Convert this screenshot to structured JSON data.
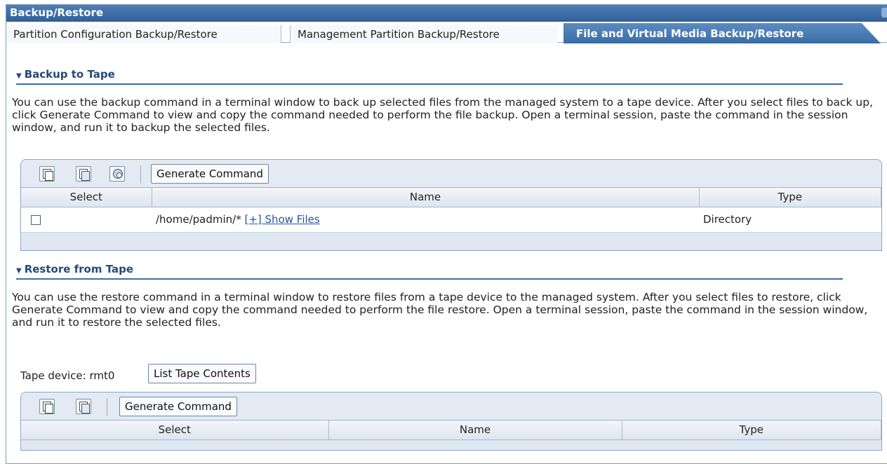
{
  "window": {
    "title": "Backup/Restore"
  },
  "tabs": [
    {
      "label": "Partition Configuration Backup/Restore"
    },
    {
      "label": "Management Partition Backup/Restore"
    },
    {
      "label": "File and Virtual Media Backup/Restore"
    }
  ],
  "backup": {
    "heading": "Backup to Tape",
    "description": "You can use the backup command in a terminal window to back up selected files from the managed system to a tape device. After you select files to back up, click Generate Command to view and copy the command needed to perform the file backup. Open a terminal session, paste the command in the session window, and run it to backup the selected files.",
    "generate_label": "Generate Command",
    "columns": {
      "select": "Select",
      "name": "Name",
      "type": "Type"
    },
    "row": {
      "path": "/home/padmin/*",
      "link": "[+] Show Files",
      "type": "Directory"
    }
  },
  "restore": {
    "heading": "Restore from Tape",
    "description": "You can use the restore command in a terminal window to restore files from a tape device to the managed system. After you select files to restore, click Generate Command to view and copy the command needed to perform the file restore. Open a terminal session, paste the command in the session window, and run it to restore the selected files.",
    "tape_label": "Tape device: rmt0",
    "list_label": "List Tape Contents",
    "generate_label": "Generate Command",
    "columns": {
      "select": "Select",
      "name": "Name",
      "type": "Type"
    }
  },
  "colors": {
    "accent": "#3a6ea5",
    "link": "#2255aa",
    "table_header": "#dfe7f1"
  }
}
